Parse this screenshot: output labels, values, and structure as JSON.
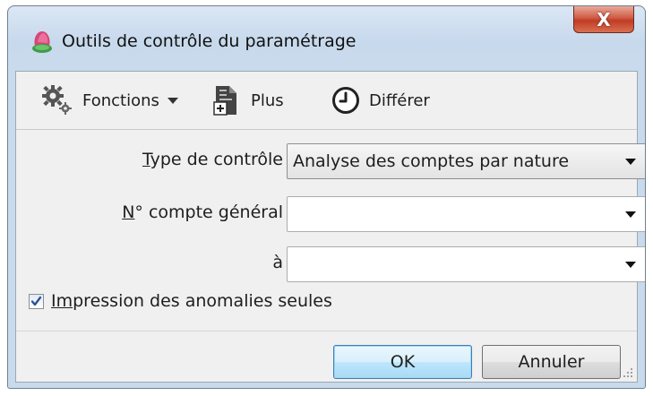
{
  "window": {
    "title": "Outils de contrôle du paramétrage",
    "close_label": "X"
  },
  "toolbar": {
    "functions_label": "Fonctions",
    "more_label": "Plus",
    "defer_label": "Différer"
  },
  "form": {
    "control_type": {
      "label_first": "T",
      "label_rest": "ype de contrôle",
      "value": "Analyse des comptes par nature"
    },
    "account_from": {
      "label_first": "N",
      "label_rest": "° compte général",
      "value": ""
    },
    "account_to": {
      "label": "à",
      "value": ""
    },
    "anomalies_only": {
      "label_first": "Im",
      "label_rest": "pression des anomalies seules",
      "checked": true
    }
  },
  "buttons": {
    "ok_label": "OK",
    "cancel_label": "Annuler"
  },
  "colors": {
    "title_bar": "#c9daec",
    "close_button": "#c8432b",
    "default_button": "#bee6fd",
    "client_bg": "#f0f0f0"
  },
  "icons": {
    "app": "app-icon",
    "functions": "gear-icon",
    "more": "document-add-icon",
    "defer": "clock-icon",
    "dropdown": "chevron-down-icon",
    "checkbox": "checkmark-icon"
  }
}
